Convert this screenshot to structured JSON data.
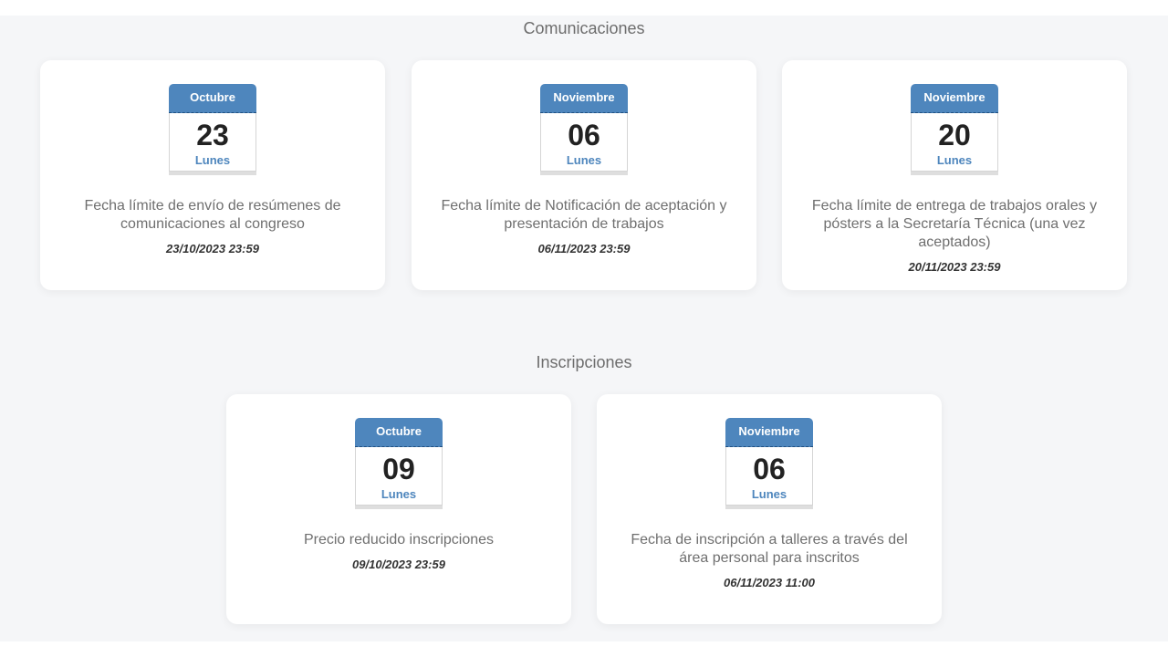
{
  "sections": [
    {
      "title": "Comunicaciones",
      "cards": [
        {
          "month": "Octubre",
          "day": "23",
          "weekday": "Lunes",
          "description": "Fecha límite de envío de resúmenes de comunicaciones al congreso",
          "datetime": "23/10/2023 23:59"
        },
        {
          "month": "Noviembre",
          "day": "06",
          "weekday": "Lunes",
          "description": "Fecha límite de Notificación de aceptación y presentación de trabajos",
          "datetime": "06/11/2023 23:59"
        },
        {
          "month": "Noviembre",
          "day": "20",
          "weekday": "Lunes",
          "description": "Fecha límite de entrega de trabajos orales y pósters a la Secretaría Técnica (una vez aceptados)",
          "datetime": "20/11/2023 23:59"
        }
      ]
    },
    {
      "title": "Inscripciones",
      "cards": [
        {
          "month": "Octubre",
          "day": "09",
          "weekday": "Lunes",
          "description": "Precio reducido inscripciones",
          "datetime": "09/10/2023 23:59"
        },
        {
          "month": "Noviembre",
          "day": "06",
          "weekday": "Lunes",
          "description": "Fecha de inscripción a talleres a través del área personal para inscritos",
          "datetime": "06/11/2023 11:00"
        }
      ]
    }
  ],
  "colors": {
    "accent": "#4e86bd",
    "background": "#f5f6f8",
    "card": "#ffffff"
  },
  "icons": [
    "calendar-icon"
  ]
}
